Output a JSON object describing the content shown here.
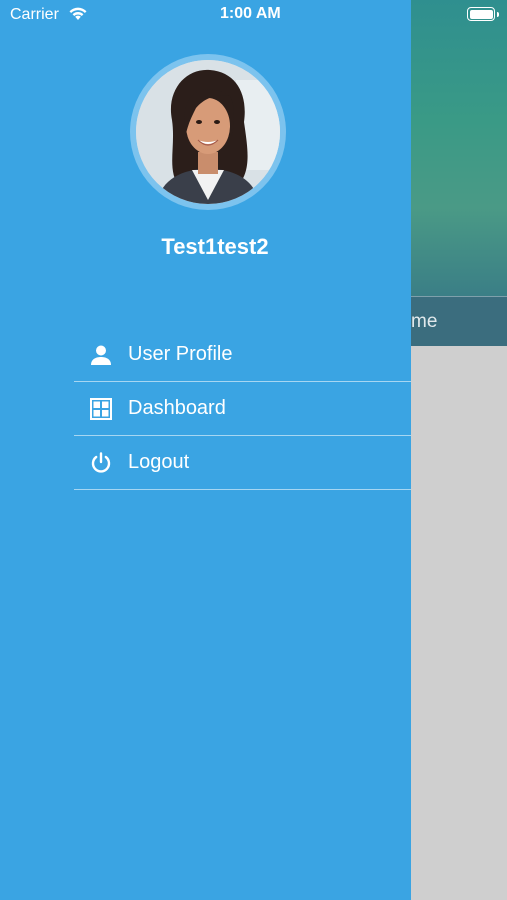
{
  "status_bar": {
    "carrier": "Carrier",
    "time": "1:00 AM"
  },
  "background": {
    "tab_label_partial": "me"
  },
  "drawer": {
    "user_name": "Test1test2",
    "menu": [
      {
        "label": "User Profile",
        "icon": "person-icon"
      },
      {
        "label": "Dashboard",
        "icon": "grid-icon"
      },
      {
        "label": "Logout",
        "icon": "power-icon"
      }
    ]
  },
  "colors": {
    "drawer_bg": "#3aa4e3",
    "avatar_ring": "#7cc3ee",
    "overlay_bg": "#cfcfcf"
  }
}
